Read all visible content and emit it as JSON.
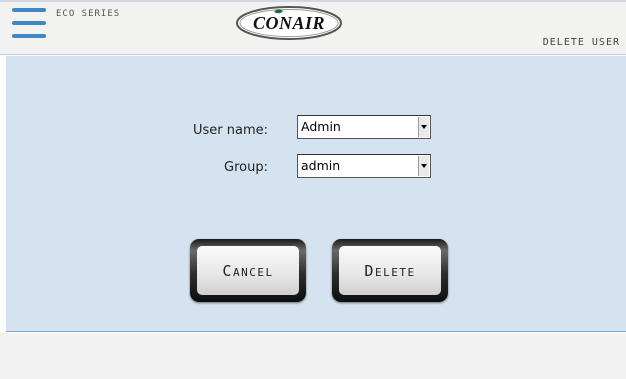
{
  "header": {
    "series_label": "ECO SERIES",
    "brand": "CONAIR",
    "screen_title": "DELETE USER"
  },
  "form": {
    "user_name_label": "User name:",
    "user_name_value": "Admin",
    "group_label": "Group:",
    "group_value": "admin"
  },
  "buttons": {
    "cancel": "Cancel",
    "delete": "Delete"
  },
  "colors": {
    "accent": "#3f88c5",
    "panel": "#d5e3f0",
    "brand_green": "#1e6b3a"
  }
}
